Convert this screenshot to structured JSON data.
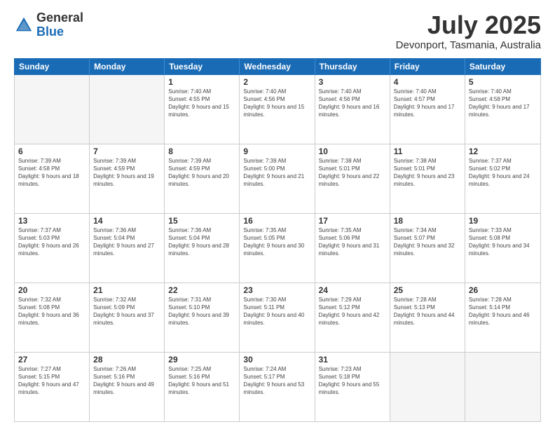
{
  "logo": {
    "general": "General",
    "blue": "Blue"
  },
  "title": "July 2025",
  "subtitle": "Devonport, Tasmania, Australia",
  "headers": [
    "Sunday",
    "Monday",
    "Tuesday",
    "Wednesday",
    "Thursday",
    "Friday",
    "Saturday"
  ],
  "weeks": [
    [
      {
        "day": "",
        "empty": true
      },
      {
        "day": "",
        "empty": true
      },
      {
        "day": "1",
        "sunrise": "Sunrise: 7:40 AM",
        "sunset": "Sunset: 4:55 PM",
        "daylight": "Daylight: 9 hours and 15 minutes."
      },
      {
        "day": "2",
        "sunrise": "Sunrise: 7:40 AM",
        "sunset": "Sunset: 4:56 PM",
        "daylight": "Daylight: 9 hours and 15 minutes."
      },
      {
        "day": "3",
        "sunrise": "Sunrise: 7:40 AM",
        "sunset": "Sunset: 4:56 PM",
        "daylight": "Daylight: 9 hours and 16 minutes."
      },
      {
        "day": "4",
        "sunrise": "Sunrise: 7:40 AM",
        "sunset": "Sunset: 4:57 PM",
        "daylight": "Daylight: 9 hours and 17 minutes."
      },
      {
        "day": "5",
        "sunrise": "Sunrise: 7:40 AM",
        "sunset": "Sunset: 4:58 PM",
        "daylight": "Daylight: 9 hours and 17 minutes."
      }
    ],
    [
      {
        "day": "6",
        "sunrise": "Sunrise: 7:39 AM",
        "sunset": "Sunset: 4:58 PM",
        "daylight": "Daylight: 9 hours and 18 minutes."
      },
      {
        "day": "7",
        "sunrise": "Sunrise: 7:39 AM",
        "sunset": "Sunset: 4:59 PM",
        "daylight": "Daylight: 9 hours and 19 minutes."
      },
      {
        "day": "8",
        "sunrise": "Sunrise: 7:39 AM",
        "sunset": "Sunset: 4:59 PM",
        "daylight": "Daylight: 9 hours and 20 minutes."
      },
      {
        "day": "9",
        "sunrise": "Sunrise: 7:39 AM",
        "sunset": "Sunset: 5:00 PM",
        "daylight": "Daylight: 9 hours and 21 minutes."
      },
      {
        "day": "10",
        "sunrise": "Sunrise: 7:38 AM",
        "sunset": "Sunset: 5:01 PM",
        "daylight": "Daylight: 9 hours and 22 minutes."
      },
      {
        "day": "11",
        "sunrise": "Sunrise: 7:38 AM",
        "sunset": "Sunset: 5:01 PM",
        "daylight": "Daylight: 9 hours and 23 minutes."
      },
      {
        "day": "12",
        "sunrise": "Sunrise: 7:37 AM",
        "sunset": "Sunset: 5:02 PM",
        "daylight": "Daylight: 9 hours and 24 minutes."
      }
    ],
    [
      {
        "day": "13",
        "sunrise": "Sunrise: 7:37 AM",
        "sunset": "Sunset: 5:03 PM",
        "daylight": "Daylight: 9 hours and 26 minutes."
      },
      {
        "day": "14",
        "sunrise": "Sunrise: 7:36 AM",
        "sunset": "Sunset: 5:04 PM",
        "daylight": "Daylight: 9 hours and 27 minutes."
      },
      {
        "day": "15",
        "sunrise": "Sunrise: 7:36 AM",
        "sunset": "Sunset: 5:04 PM",
        "daylight": "Daylight: 9 hours and 28 minutes."
      },
      {
        "day": "16",
        "sunrise": "Sunrise: 7:35 AM",
        "sunset": "Sunset: 5:05 PM",
        "daylight": "Daylight: 9 hours and 30 minutes."
      },
      {
        "day": "17",
        "sunrise": "Sunrise: 7:35 AM",
        "sunset": "Sunset: 5:06 PM",
        "daylight": "Daylight: 9 hours and 31 minutes."
      },
      {
        "day": "18",
        "sunrise": "Sunrise: 7:34 AM",
        "sunset": "Sunset: 5:07 PM",
        "daylight": "Daylight: 9 hours and 32 minutes."
      },
      {
        "day": "19",
        "sunrise": "Sunrise: 7:33 AM",
        "sunset": "Sunset: 5:08 PM",
        "daylight": "Daylight: 9 hours and 34 minutes."
      }
    ],
    [
      {
        "day": "20",
        "sunrise": "Sunrise: 7:32 AM",
        "sunset": "Sunset: 5:08 PM",
        "daylight": "Daylight: 9 hours and 36 minutes."
      },
      {
        "day": "21",
        "sunrise": "Sunrise: 7:32 AM",
        "sunset": "Sunset: 5:09 PM",
        "daylight": "Daylight: 9 hours and 37 minutes."
      },
      {
        "day": "22",
        "sunrise": "Sunrise: 7:31 AM",
        "sunset": "Sunset: 5:10 PM",
        "daylight": "Daylight: 9 hours and 39 minutes."
      },
      {
        "day": "23",
        "sunrise": "Sunrise: 7:30 AM",
        "sunset": "Sunset: 5:11 PM",
        "daylight": "Daylight: 9 hours and 40 minutes."
      },
      {
        "day": "24",
        "sunrise": "Sunrise: 7:29 AM",
        "sunset": "Sunset: 5:12 PM",
        "daylight": "Daylight: 9 hours and 42 minutes."
      },
      {
        "day": "25",
        "sunrise": "Sunrise: 7:28 AM",
        "sunset": "Sunset: 5:13 PM",
        "daylight": "Daylight: 9 hours and 44 minutes."
      },
      {
        "day": "26",
        "sunrise": "Sunrise: 7:28 AM",
        "sunset": "Sunset: 5:14 PM",
        "daylight": "Daylight: 9 hours and 46 minutes."
      }
    ],
    [
      {
        "day": "27",
        "sunrise": "Sunrise: 7:27 AM",
        "sunset": "Sunset: 5:15 PM",
        "daylight": "Daylight: 9 hours and 47 minutes."
      },
      {
        "day": "28",
        "sunrise": "Sunrise: 7:26 AM",
        "sunset": "Sunset: 5:16 PM",
        "daylight": "Daylight: 9 hours and 49 minutes."
      },
      {
        "day": "29",
        "sunrise": "Sunrise: 7:25 AM",
        "sunset": "Sunset: 5:16 PM",
        "daylight": "Daylight: 9 hours and 51 minutes."
      },
      {
        "day": "30",
        "sunrise": "Sunrise: 7:24 AM",
        "sunset": "Sunset: 5:17 PM",
        "daylight": "Daylight: 9 hours and 53 minutes."
      },
      {
        "day": "31",
        "sunrise": "Sunrise: 7:23 AM",
        "sunset": "Sunset: 5:18 PM",
        "daylight": "Daylight: 9 hours and 55 minutes."
      },
      {
        "day": "",
        "empty": true
      },
      {
        "day": "",
        "empty": true
      }
    ]
  ]
}
